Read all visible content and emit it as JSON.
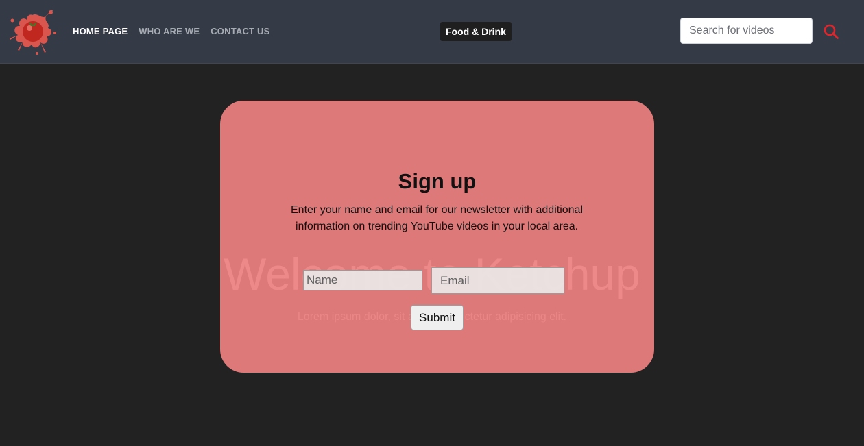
{
  "header": {
    "logo_icon": "ketchup-splash-logo-icon",
    "nav": [
      {
        "label": "HOME PAGE",
        "active": true
      },
      {
        "label": "WHO ARE WE",
        "active": false
      },
      {
        "label": "CONTACT US",
        "active": false
      }
    ],
    "category_badge": "Food & Drink",
    "search": {
      "placeholder": "Search for videos",
      "value": ""
    },
    "search_icon": "search-icon",
    "accent_color": "#e0262b"
  },
  "hero": {
    "title": "Welcome to Ketchup",
    "subtitle": "Lorem ipsum dolor, sit amet consectetur adipisicing elit."
  },
  "signup": {
    "title": "Sign up",
    "description": "Enter your name and email for our newsletter with additional information on trending YouTube videos in your local area.",
    "name_placeholder": "Name",
    "email_placeholder": "Email",
    "submit_label": "Submit",
    "card_color": "#ec8080"
  }
}
